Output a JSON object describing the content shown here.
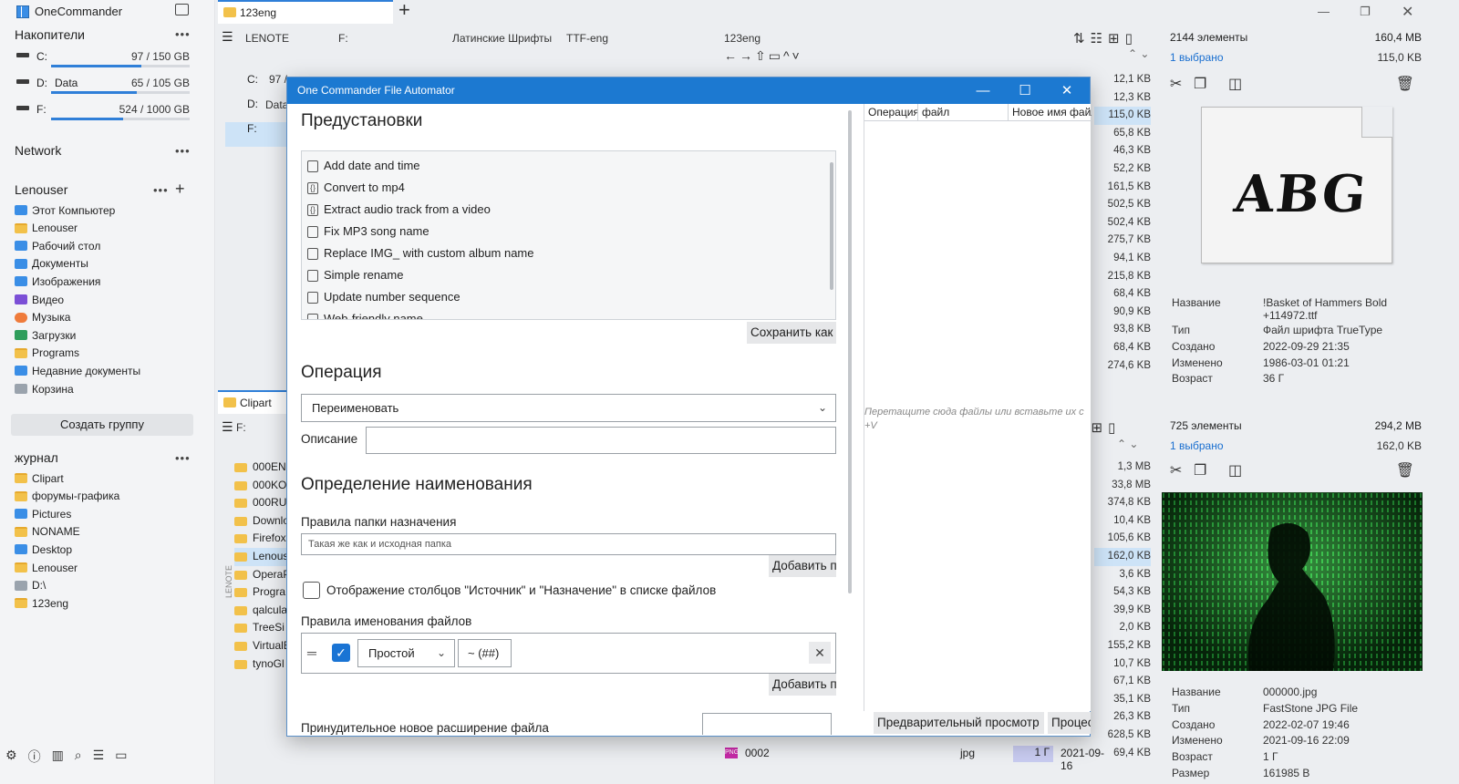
{
  "app_title": "OneCommander",
  "sidebar": {
    "drives_header": "Накопители",
    "drives": [
      {
        "letter": "C:",
        "name": "",
        "size": "97 / 150 GB",
        "used_fraction": 0.65
      },
      {
        "letter": "D:",
        "name": "Data",
        "size": "65 / 105 GB",
        "used_fraction": 0.62
      },
      {
        "letter": "F:",
        "name": "",
        "size": "524 / 1000 GB",
        "used_fraction": 0.52
      }
    ],
    "network_label": "Network",
    "user_header": "Lenouser",
    "user_items": [
      {
        "label": "Этот Компьютер",
        "icon": "computer-icon"
      },
      {
        "label": "Lenouser",
        "icon": "folder-icon"
      },
      {
        "label": "Рабочий стол",
        "icon": "desktop-icon"
      },
      {
        "label": "Документы",
        "icon": "documents-icon"
      },
      {
        "label": "Изображения",
        "icon": "pictures-icon"
      },
      {
        "label": "Видео",
        "icon": "video-icon"
      },
      {
        "label": "Музыка",
        "icon": "music-icon"
      },
      {
        "label": "Загрузки",
        "icon": "download-icon"
      },
      {
        "label": "Programs",
        "icon": "folder-icon"
      },
      {
        "label": "Недавние документы",
        "icon": "recent-icon"
      },
      {
        "label": "Корзина",
        "icon": "recycle-bin-icon"
      }
    ],
    "create_group": "Создать группу",
    "journal_header": "журнал",
    "journal_items": [
      "Clipart",
      "форумы-графика",
      "Pictures",
      "NONAME",
      "Desktop",
      "Lenouser",
      "D:\\",
      "123eng"
    ]
  },
  "tabs": {
    "top": "123eng",
    "bottom": "Clipart"
  },
  "breadcrumbs": [
    "LENOTE",
    "F:",
    "Латинские Шрифты",
    "TTF-eng",
    "123eng"
  ],
  "bg_left_drives": [
    "C:",
    "D:",
    "F:"
  ],
  "bg_left_drive_fragments": [
    "97 /",
    "Data"
  ],
  "bg_bottom_files": [
    "000EN",
    "000KOI",
    "000RUS",
    "Downlo",
    "Firefox",
    "Lenous",
    "OperaP",
    "Progra",
    "qalcula",
    "TreeSi",
    "VirtualE",
    "tynoGl"
  ],
  "bg_bottom_path": "F:",
  "file_sizes_top": [
    "12,1 KB",
    "12,3 KB",
    "115,0 KB",
    "65,8 KB",
    "46,3 KB",
    "52,2 KB",
    "161,5 KB",
    "502,5 KB",
    "502,4 KB",
    "275,7 KB",
    "94,1 KB",
    "215,8 KB",
    "68,4 KB",
    "90,9 KB",
    "93,8 KB",
    "68,4 KB",
    "274,6 KB"
  ],
  "file_sizes_bottom": [
    "1,3 MB",
    "33,8 MB",
    "374,8 KB",
    "10,4 KB",
    "105,6 KB",
    "162,0 KB",
    "3,6 KB",
    "54,3 KB",
    "39,9 KB",
    "2,0 KB",
    "155,2 KB",
    "10,7 KB",
    "67,1 KB",
    "35,1 KB",
    "26,3 KB",
    "628,5 KB",
    "69,4 KB"
  ],
  "bottom_row": {
    "name": "0002",
    "ext": "jpg",
    "age": "1 Г",
    "date": "2021-09-16",
    "size": "69,4 KB"
  },
  "info_top": {
    "count": "2144 элементы",
    "total": "160,4 MB",
    "selected": "1 выбрано",
    "sel_size": "115,0 KB",
    "preview_text": "ABG",
    "rows": [
      [
        "Название",
        "!Basket of Hammers Bold +114972.ttf"
      ],
      [
        "Тип",
        "Файл шрифта TrueType"
      ],
      [
        "Создано",
        "2022-09-29  21:35"
      ],
      [
        "Изменено",
        "1986-03-01  01:21"
      ],
      [
        "Возраст",
        "36 Г"
      ]
    ]
  },
  "info_bottom": {
    "count": "725 элементы",
    "total": "294,2 MB",
    "selected": "1 выбрано",
    "sel_size": "162,0 KB",
    "rows": [
      [
        "Название",
        "000000.jpg"
      ],
      [
        "Тип",
        "FastStone JPG File"
      ],
      [
        "Создано",
        "2022-02-07  19:46"
      ],
      [
        "Изменено",
        "2021-09-16  22:09"
      ],
      [
        "Возраст",
        "1 Г"
      ],
      [
        "Размер",
        "161985 B"
      ]
    ]
  },
  "dialog": {
    "title": "One Commander File Automator",
    "presets_header": "Предустановки",
    "presets": [
      {
        "label": "Add date and time",
        "icon": "book-icon"
      },
      {
        "label": "Convert to mp4",
        "icon": "braces-icon"
      },
      {
        "label": "Extract audio track from a video",
        "icon": "braces-icon"
      },
      {
        "label": "Fix MP3 song name",
        "icon": "book-icon"
      },
      {
        "label": "Replace IMG_ with custom album name",
        "icon": "book-icon"
      },
      {
        "label": "Simple rename",
        "icon": "book-icon"
      },
      {
        "label": "Update number sequence",
        "icon": "book-icon"
      },
      {
        "label": "Web-friendly name",
        "icon": "book-icon"
      }
    ],
    "save_as": "Сохранить как",
    "operation_header": "Операция",
    "operation_value": "Переименовать",
    "description_label": "Описание",
    "description_value": "",
    "naming_header": "Определение наименования",
    "dest_rules_label": "Правила папки назначения",
    "dest_placeholder": "Такая же как и исходная папка",
    "add_btn": "Добавить п",
    "show_columns_label": "Отображение столбцов \"Источник\" и \"Назначение\" в списке файлов",
    "naming_rules_label": "Правила именования файлов",
    "rule_type": "Простой",
    "rule_pattern": "~ (##)",
    "force_ext_label": "Принудительное новое расширение файла",
    "table_headers": [
      "Операция",
      "файл",
      "Новое имя файл"
    ],
    "drop_hint": "Перетащите сюда файлы или вставьте их с",
    "drop_hint_2": "+V",
    "preview_btn": "Предварительный просмотр",
    "process_btn": "Процес"
  }
}
